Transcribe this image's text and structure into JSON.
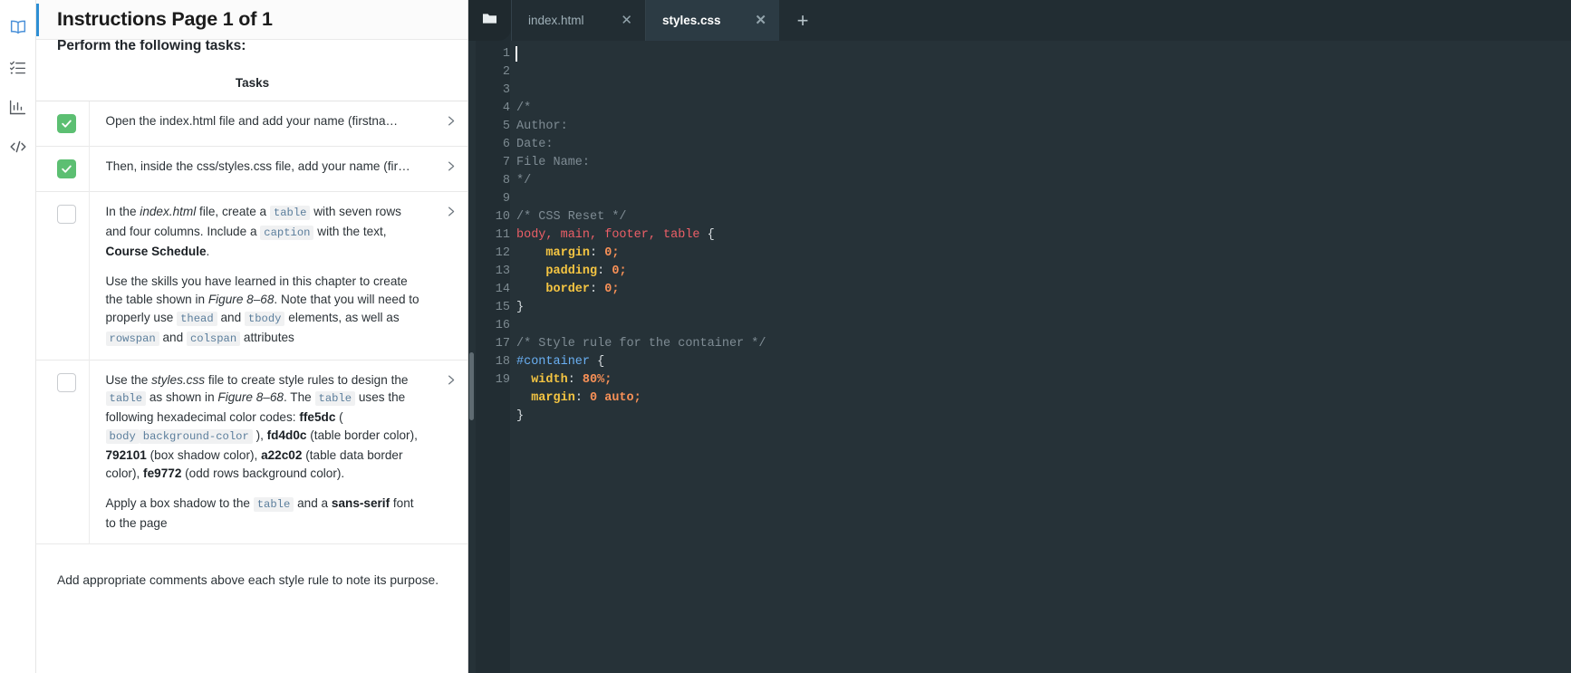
{
  "rail": {
    "items": [
      {
        "name": "book-icon",
        "label": "Instructions",
        "active": true
      },
      {
        "name": "checklist-icon",
        "label": "Tasks",
        "active": false
      },
      {
        "name": "bar-chart-icon",
        "label": "Progress",
        "active": false
      },
      {
        "name": "code-icon",
        "label": "Code",
        "active": false
      }
    ]
  },
  "instructions": {
    "title": "Instructions Page 1 of 1",
    "perform_line": "Perform the following tasks:",
    "table_header": "Tasks",
    "footer_note": "Add appropriate comments above each style rule to note its purpose.",
    "tasks": [
      {
        "checked": true,
        "text": "Open the index.html file and add your name (firstna…"
      },
      {
        "checked": true,
        "text": "Then, inside the css/styles.css file, add your name (fir…"
      },
      {
        "checked": false,
        "p1_a": "In the ",
        "p1_file": "index.html",
        "p1_b": " file, create a ",
        "p1_code1": "table",
        "p1_c": " with seven rows and four columns. Include a ",
        "p1_code2": "caption",
        "p1_d": " with the text, ",
        "p1_bold": "Course Schedule",
        "p1_e": ".",
        "p2_a": "Use the skills you have learned in this chapter to create the table shown in ",
        "p2_fig": "Figure 8–68",
        "p2_b": ". Note that you will need to properly use ",
        "p2_code1": "thead",
        "p2_c": " and ",
        "p2_code2": "tbody",
        "p2_d": " elements, as well as ",
        "p2_code3": "rowspan",
        "p2_e": " and ",
        "p2_code4": "colspan",
        "p2_f": " attributes"
      },
      {
        "checked": false,
        "p1_a": "Use the ",
        "p1_file": "styles.css",
        "p1_b": " file to create style rules to design the ",
        "p1_code1": "table",
        "p1_c": " as shown in ",
        "p1_fig": "Figure 8–68",
        "p1_d": ". The ",
        "p1_code2": "table",
        "p1_e": " uses the following hexadecimal color codes: ",
        "p1_hex1": "ffe5dc",
        "p1_f": " ( ",
        "p1_code3": "body",
        "p1_code4": "background-color",
        "p1_g": " ), ",
        "p1_hex2": "fd4d0c",
        "p1_h": " (table border color), ",
        "p1_hex3": "792101",
        "p1_i": " (box shadow color), ",
        "p1_hex4": "a22c02",
        "p1_j": " (table data border color), ",
        "p1_hex5": "fe9772",
        "p1_k": " (odd rows background color).",
        "p2_a": "Apply a box shadow to the ",
        "p2_code1": "table",
        "p2_b": " and a ",
        "p2_bold": "sans-serif",
        "p2_c": " font to the page"
      }
    ]
  },
  "editor": {
    "tabs": [
      {
        "label": "index.html",
        "active": false,
        "close": "✕"
      },
      {
        "label": "styles.css",
        "active": true,
        "close": "✕"
      }
    ],
    "new_tab_label": "+",
    "line_numbers": [
      "1",
      "2",
      "3",
      "4",
      "5",
      "6",
      "7",
      "8",
      "9",
      "10",
      "11",
      "12",
      "13",
      "14",
      "15",
      "16",
      "17",
      "18",
      "19"
    ],
    "lines": [
      {
        "n": 1,
        "tokens": [
          {
            "t": "/*",
            "c": "cmt"
          }
        ]
      },
      {
        "n": 2,
        "tokens": [
          {
            "t": "Author:",
            "c": "cmt"
          }
        ]
      },
      {
        "n": 3,
        "tokens": [
          {
            "t": "Date:",
            "c": "cmt"
          }
        ]
      },
      {
        "n": 4,
        "tokens": [
          {
            "t": "File Name:",
            "c": "cmt"
          }
        ]
      },
      {
        "n": 5,
        "tokens": [
          {
            "t": "*/",
            "c": "cmt"
          }
        ]
      },
      {
        "n": 6,
        "tokens": [
          {
            "t": "",
            "c": "punc"
          }
        ]
      },
      {
        "n": 7,
        "tokens": [
          {
            "t": "/* CSS Reset */",
            "c": "cmt"
          }
        ]
      },
      {
        "n": 8,
        "tokens": [
          {
            "t": "body, main, footer, table",
            "c": "sel"
          },
          {
            "t": " {",
            "c": "brace"
          }
        ]
      },
      {
        "n": 9,
        "tokens": [
          {
            "t": "    margin",
            "c": "prop"
          },
          {
            "t": ": ",
            "c": "punc"
          },
          {
            "t": "0",
            "c": "val"
          },
          {
            "t": ";",
            "c": "val"
          }
        ]
      },
      {
        "n": 10,
        "tokens": [
          {
            "t": "    padding",
            "c": "prop"
          },
          {
            "t": ": ",
            "c": "punc"
          },
          {
            "t": "0",
            "c": "val"
          },
          {
            "t": ";",
            "c": "val"
          }
        ]
      },
      {
        "n": 11,
        "tokens": [
          {
            "t": "    border",
            "c": "prop"
          },
          {
            "t": ": ",
            "c": "punc"
          },
          {
            "t": "0",
            "c": "val"
          },
          {
            "t": ";",
            "c": "val"
          }
        ]
      },
      {
        "n": 12,
        "tokens": [
          {
            "t": "}",
            "c": "brace"
          }
        ]
      },
      {
        "n": 13,
        "tokens": [
          {
            "t": "",
            "c": "punc"
          }
        ]
      },
      {
        "n": 14,
        "tokens": [
          {
            "t": "/* Style rule for the container */",
            "c": "cmt"
          }
        ]
      },
      {
        "n": 15,
        "tokens": [
          {
            "t": "#container",
            "c": "id"
          },
          {
            "t": " {",
            "c": "brace"
          }
        ]
      },
      {
        "n": 16,
        "tokens": [
          {
            "t": "  width",
            "c": "prop"
          },
          {
            "t": ": ",
            "c": "punc"
          },
          {
            "t": "80%",
            "c": "val"
          },
          {
            "t": ";",
            "c": "val"
          }
        ]
      },
      {
        "n": 17,
        "tokens": [
          {
            "t": "  margin",
            "c": "prop"
          },
          {
            "t": ": ",
            "c": "punc"
          },
          {
            "t": "0 auto",
            "c": "val"
          },
          {
            "t": ";",
            "c": "val"
          }
        ]
      },
      {
        "n": 18,
        "tokens": [
          {
            "t": "}",
            "c": "brace"
          }
        ]
      },
      {
        "n": 19,
        "tokens": [
          {
            "t": "",
            "c": "punc"
          }
        ]
      }
    ]
  },
  "colors": {
    "accent_blue": "#2e8fd4",
    "checkbox_green": "#5cbf72",
    "editor_bg": "#263238",
    "gutter_bg": "#222d33",
    "tab_active_bg": "#2c3b44",
    "syntax_comment": "#7f8c94",
    "syntax_selector": "#ec5f67",
    "syntax_property": "#f5c542",
    "syntax_value": "#f99157",
    "syntax_id": "#6ab0f3"
  }
}
